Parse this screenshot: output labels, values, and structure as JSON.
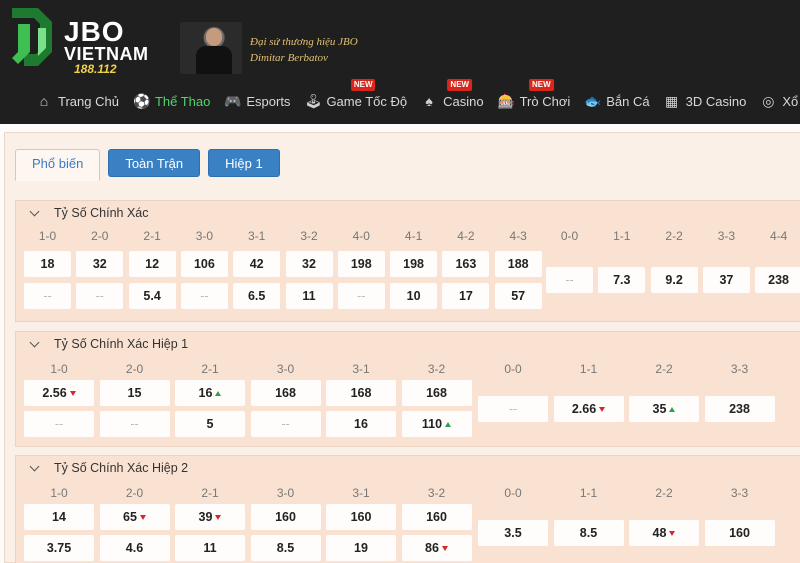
{
  "brand": {
    "name": "JBO",
    "country": "VIETNAM",
    "number": "188.112"
  },
  "ambassador": {
    "line1": "Đại sứ thương hiệu JBO",
    "line2": "Dimitar Berbatov"
  },
  "nav": [
    {
      "label": "Trang Chủ",
      "icon": "home-icon",
      "glyph": "⌂",
      "active": false,
      "badge": ""
    },
    {
      "label": "Thể Thao",
      "icon": "soccer-ball-icon",
      "glyph": "⚽",
      "active": true,
      "badge": ""
    },
    {
      "label": "Esports",
      "icon": "gamepad-icon",
      "glyph": "🎮",
      "active": false,
      "badge": ""
    },
    {
      "label": "Game Tốc Độ",
      "icon": "joystick-icon",
      "glyph": "🕹",
      "active": false,
      "badge": "NEW"
    },
    {
      "label": "Casino",
      "icon": "casino-chip-icon",
      "glyph": "♠",
      "active": false,
      "badge": "NEW"
    },
    {
      "label": "Trò Chơi",
      "icon": "slot-machine-icon",
      "glyph": "🎰",
      "active": false,
      "badge": "NEW"
    },
    {
      "label": "Bắn Cá",
      "icon": "fish-icon",
      "glyph": "🐟",
      "active": false,
      "badge": ""
    },
    {
      "label": "3D Casino",
      "icon": "cube-icon",
      "glyph": "▦",
      "active": false,
      "badge": ""
    },
    {
      "label": "Xổ S",
      "icon": "lottery-icon",
      "glyph": "◎",
      "active": false,
      "badge": ""
    }
  ],
  "tabs": [
    {
      "label": "Phổ biến",
      "style": "active"
    },
    {
      "label": "Toàn Trận",
      "style": "primary"
    },
    {
      "label": "Hiệp 1",
      "style": "primary"
    }
  ],
  "sections": [
    {
      "title": "Tỷ Số Chính Xác",
      "cols_a": [
        {
          "label": "1-0",
          "top": "18",
          "bottom": "--"
        },
        {
          "label": "2-0",
          "top": "32",
          "bottom": "--"
        },
        {
          "label": "2-1",
          "top": "12",
          "bottom": "5.4"
        },
        {
          "label": "3-0",
          "top": "106",
          "bottom": "--"
        },
        {
          "label": "3-1",
          "top": "42",
          "bottom": "6.5"
        },
        {
          "label": "3-2",
          "top": "32",
          "bottom": "11"
        },
        {
          "label": "4-0",
          "top": "198",
          "bottom": "--"
        },
        {
          "label": "4-1",
          "top": "198",
          "bottom": "10"
        },
        {
          "label": "4-2",
          "top": "163",
          "bottom": "17"
        },
        {
          "label": "4-3",
          "top": "188",
          "bottom": "57"
        }
      ],
      "cols_b": [
        {
          "label": "0-0",
          "value": "--"
        },
        {
          "label": "1-1",
          "value": "7.3"
        },
        {
          "label": "2-2",
          "value": "9.2"
        },
        {
          "label": "3-3",
          "value": "37"
        },
        {
          "label": "4-4",
          "value": "238"
        }
      ]
    },
    {
      "title": "Tỷ Số Chính Xác Hiệp 1",
      "cols_a": [
        {
          "label": "1-0",
          "top": "2.56",
          "top_trend": "down",
          "bottom": "--",
          "bottom_trend": ""
        },
        {
          "label": "2-0",
          "top": "15",
          "top_trend": "",
          "bottom": "--",
          "bottom_trend": ""
        },
        {
          "label": "2-1",
          "top": "16",
          "top_trend": "up",
          "bottom": "5",
          "bottom_trend": ""
        },
        {
          "label": "3-0",
          "top": "168",
          "top_trend": "",
          "bottom": "--",
          "bottom_trend": ""
        },
        {
          "label": "3-1",
          "top": "168",
          "top_trend": "",
          "bottom": "16",
          "bottom_trend": ""
        },
        {
          "label": "3-2",
          "top": "168",
          "top_trend": "",
          "bottom": "110",
          "bottom_trend": "up"
        }
      ],
      "cols_b": [
        {
          "label": "0-0",
          "value": "--",
          "trend": ""
        },
        {
          "label": "1-1",
          "value": "2.66",
          "trend": "down"
        },
        {
          "label": "2-2",
          "value": "35",
          "trend": "up"
        },
        {
          "label": "3-3",
          "value": "238",
          "trend": ""
        }
      ]
    },
    {
      "title": "Tỷ Số Chính Xác Hiệp 2",
      "cols_a": [
        {
          "label": "1-0",
          "top": "14",
          "top_trend": "",
          "bottom": "3.75",
          "bottom_trend": ""
        },
        {
          "label": "2-0",
          "top": "65",
          "top_trend": "down",
          "bottom": "4.6",
          "bottom_trend": ""
        },
        {
          "label": "2-1",
          "top": "39",
          "top_trend": "down",
          "bottom": "11",
          "bottom_trend": ""
        },
        {
          "label": "3-0",
          "top": "160",
          "top_trend": "",
          "bottom": "8.5",
          "bottom_trend": ""
        },
        {
          "label": "3-1",
          "top": "160",
          "top_trend": "",
          "bottom": "19",
          "bottom_trend": ""
        },
        {
          "label": "3-2",
          "top": "160",
          "top_trend": "",
          "bottom": "86",
          "bottom_trend": "down"
        }
      ],
      "cols_b": [
        {
          "label": "0-0",
          "value": "3.5",
          "trend": ""
        },
        {
          "label": "1-1",
          "value": "8.5",
          "trend": ""
        },
        {
          "label": "2-2",
          "value": "48",
          "trend": "down"
        },
        {
          "label": "3-3",
          "value": "160",
          "trend": ""
        }
      ]
    }
  ],
  "colors": {
    "header_bg": "#1f1f1f",
    "brand_green": "#52d46d",
    "tab_blue": "#3a81c4",
    "section_bg": "#f9e2d2",
    "arrow_down": "#d8262b",
    "arrow_up": "#2aa24a"
  }
}
